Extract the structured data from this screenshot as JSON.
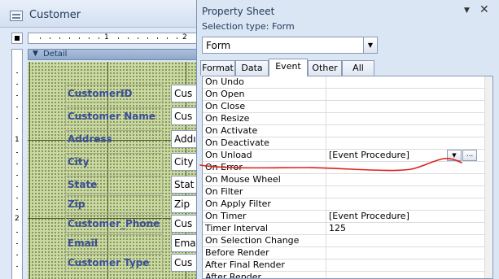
{
  "form_window": {
    "title": "Customer",
    "ruler_marks": [
      "1",
      "2"
    ],
    "vruler_marks": [
      "1",
      "2"
    ],
    "section_label": "Detail",
    "fields": [
      {
        "label": "CustomerID",
        "value": "Cus"
      },
      {
        "label": "Customer Name",
        "value": "Cus"
      },
      {
        "label": "Address",
        "value": "Addı"
      },
      {
        "label": "City",
        "value": "City"
      },
      {
        "label": "State",
        "value": "Stat"
      },
      {
        "label": "Zip",
        "value": "Zip"
      },
      {
        "label": "Customer_Phone",
        "value": "Cus"
      },
      {
        "label": "Email",
        "value": "Ema"
      },
      {
        "label": "Customer Type",
        "value": "Cus"
      }
    ]
  },
  "property_sheet": {
    "title": "Property Sheet",
    "selection_type": "Selection type:  Form",
    "selected_object": "Form",
    "tabs": [
      "Format",
      "Data",
      "Event",
      "Other",
      "All"
    ],
    "active_tab": "Event",
    "properties": [
      {
        "name": "On Undo",
        "value": ""
      },
      {
        "name": "On Open",
        "value": ""
      },
      {
        "name": "On Close",
        "value": ""
      },
      {
        "name": "On Resize",
        "value": ""
      },
      {
        "name": "On Activate",
        "value": ""
      },
      {
        "name": "On Deactivate",
        "value": ""
      },
      {
        "name": "On Unload",
        "value": "[Event Procedure]"
      },
      {
        "name": "On Error",
        "value": ""
      },
      {
        "name": "On Mouse Wheel",
        "value": ""
      },
      {
        "name": "On Filter",
        "value": ""
      },
      {
        "name": "On Apply Filter",
        "value": ""
      },
      {
        "name": "On Timer",
        "value": "[Event Procedure]"
      },
      {
        "name": "Timer Interval",
        "value": "125"
      },
      {
        "name": "On Selection Change",
        "value": ""
      },
      {
        "name": "Before Render",
        "value": ""
      },
      {
        "name": "After Final Render",
        "value": ""
      },
      {
        "name": "After Render",
        "value": ""
      }
    ]
  },
  "colors": {
    "annotation_stroke": "#e0201c",
    "label_text": "#3b4e97",
    "grid_fill": "#c9d9a0"
  }
}
